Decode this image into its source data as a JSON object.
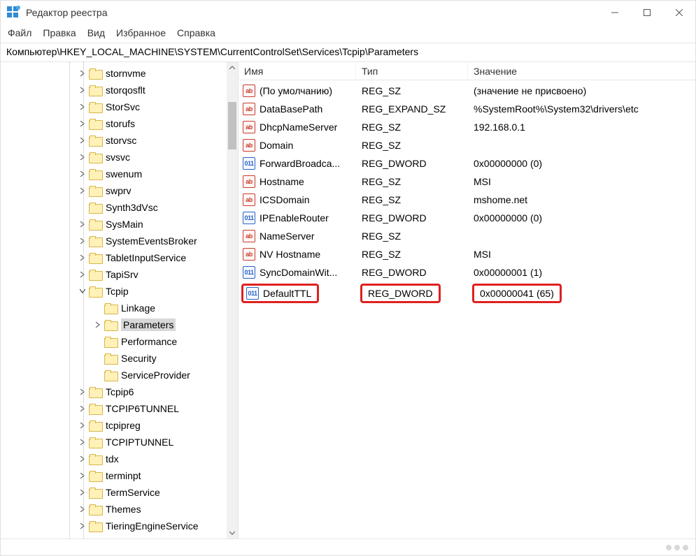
{
  "window": {
    "title": "Редактор реестра"
  },
  "menu": [
    "Файл",
    "Правка",
    "Вид",
    "Избранное",
    "Справка"
  ],
  "address": "Компьютер\\HKEY_LOCAL_MACHINE\\SYSTEM\\CurrentControlSet\\Services\\Tcpip\\Parameters",
  "tree": {
    "indent_root": 110,
    "items": [
      {
        "label": "stornvme",
        "depth": 0,
        "expander": "closed"
      },
      {
        "label": "storqosflt",
        "depth": 0,
        "expander": "closed"
      },
      {
        "label": "StorSvc",
        "depth": 0,
        "expander": "closed"
      },
      {
        "label": "storufs",
        "depth": 0,
        "expander": "closed"
      },
      {
        "label": "storvsc",
        "depth": 0,
        "expander": "closed"
      },
      {
        "label": "svsvc",
        "depth": 0,
        "expander": "closed"
      },
      {
        "label": "swenum",
        "depth": 0,
        "expander": "closed"
      },
      {
        "label": "swprv",
        "depth": 0,
        "expander": "closed"
      },
      {
        "label": "Synth3dVsc",
        "depth": 0,
        "expander": "none"
      },
      {
        "label": "SysMain",
        "depth": 0,
        "expander": "closed"
      },
      {
        "label": "SystemEventsBroker",
        "depth": 0,
        "expander": "closed"
      },
      {
        "label": "TabletInputService",
        "depth": 0,
        "expander": "closed"
      },
      {
        "label": "TapiSrv",
        "depth": 0,
        "expander": "closed"
      },
      {
        "label": "Tcpip",
        "depth": 0,
        "expander": "open"
      },
      {
        "label": "Linkage",
        "depth": 1,
        "expander": "none"
      },
      {
        "label": "Parameters",
        "depth": 1,
        "expander": "closed",
        "selected": true
      },
      {
        "label": "Performance",
        "depth": 1,
        "expander": "none"
      },
      {
        "label": "Security",
        "depth": 1,
        "expander": "none"
      },
      {
        "label": "ServiceProvider",
        "depth": 1,
        "expander": "none"
      },
      {
        "label": "Tcpip6",
        "depth": 0,
        "expander": "closed"
      },
      {
        "label": "TCPIP6TUNNEL",
        "depth": 0,
        "expander": "closed"
      },
      {
        "label": "tcpipreg",
        "depth": 0,
        "expander": "closed"
      },
      {
        "label": "TCPIPTUNNEL",
        "depth": 0,
        "expander": "closed"
      },
      {
        "label": "tdx",
        "depth": 0,
        "expander": "closed"
      },
      {
        "label": "terminpt",
        "depth": 0,
        "expander": "closed"
      },
      {
        "label": "TermService",
        "depth": 0,
        "expander": "closed"
      },
      {
        "label": "Themes",
        "depth": 0,
        "expander": "closed"
      },
      {
        "label": "TieringEngineService",
        "depth": 0,
        "expander": "closed"
      }
    ],
    "scrollbar": {
      "thumb_top_pct": 6,
      "thumb_height_pct": 10
    }
  },
  "columns": {
    "name": "Имя",
    "type": "Тип",
    "value": "Значение"
  },
  "values": [
    {
      "name": "(По умолчанию)",
      "type": "REG_SZ",
      "typecls": "sz",
      "value": "(значение не присвоено)"
    },
    {
      "name": "DataBasePath",
      "type": "REG_EXPAND_SZ",
      "typecls": "sz",
      "value": "%SystemRoot%\\System32\\drivers\\etc"
    },
    {
      "name": "DhcpNameServer",
      "type": "REG_SZ",
      "typecls": "sz",
      "value": "192.168.0.1"
    },
    {
      "name": "Domain",
      "type": "REG_SZ",
      "typecls": "sz",
      "value": ""
    },
    {
      "name": "ForwardBroadca...",
      "type": "REG_DWORD",
      "typecls": "dw",
      "value": "0x00000000 (0)"
    },
    {
      "name": "Hostname",
      "type": "REG_SZ",
      "typecls": "sz",
      "value": "MSI"
    },
    {
      "name": "ICSDomain",
      "type": "REG_SZ",
      "typecls": "sz",
      "value": "mshome.net"
    },
    {
      "name": "IPEnableRouter",
      "type": "REG_DWORD",
      "typecls": "dw",
      "value": "0x00000000 (0)"
    },
    {
      "name": "NameServer",
      "type": "REG_SZ",
      "typecls": "sz",
      "value": ""
    },
    {
      "name": "NV Hostname",
      "type": "REG_SZ",
      "typecls": "sz",
      "value": "MSI"
    },
    {
      "name": "SyncDomainWit...",
      "type": "REG_DWORD",
      "typecls": "dw",
      "value": "0x00000001 (1)"
    },
    {
      "name": "DefaultTTL",
      "type": "REG_DWORD",
      "typecls": "dw",
      "value": "0x00000041 (65)",
      "highlight": true
    }
  ]
}
